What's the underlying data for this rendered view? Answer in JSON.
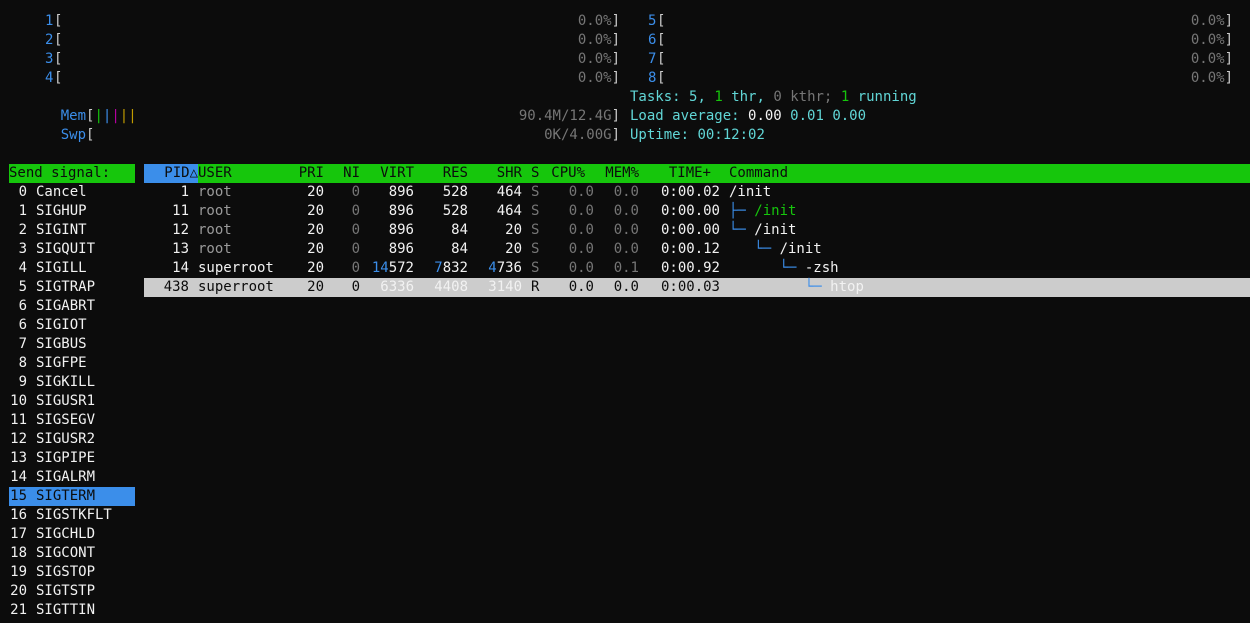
{
  "cpus_left": [
    {
      "num": "1",
      "value": "0.0%"
    },
    {
      "num": "2",
      "value": "0.0%"
    },
    {
      "num": "3",
      "value": "0.0%"
    },
    {
      "num": "4",
      "value": "0.0%"
    }
  ],
  "cpus_right": [
    {
      "num": "5",
      "value": "0.0%"
    },
    {
      "num": "6",
      "value": "0.0%"
    },
    {
      "num": "7",
      "value": "0.0%"
    },
    {
      "num": "8",
      "value": "0.0%"
    }
  ],
  "mem": {
    "label": "Mem",
    "value": "90.4M/12.4G"
  },
  "swp": {
    "label": "Swp",
    "value": "0K/4.00G"
  },
  "tasks": {
    "label": "Tasks:",
    "count": "5,",
    "thr": "1",
    "thr_label": "thr,",
    "kthr": "0",
    "kthr_label": "kthr;",
    "running": "1",
    "running_label": "running"
  },
  "load": {
    "label": "Load average:",
    "v1": "0.00",
    "v5": "0.01",
    "v15": "0.00"
  },
  "uptime": {
    "label": "Uptime:",
    "value": "00:12:02"
  },
  "signal_panel": {
    "title": "Send signal:",
    "items": [
      {
        "num": "0",
        "name": "Cancel"
      },
      {
        "num": "1",
        "name": "SIGHUP"
      },
      {
        "num": "2",
        "name": "SIGINT"
      },
      {
        "num": "3",
        "name": "SIGQUIT"
      },
      {
        "num": "4",
        "name": "SIGILL"
      },
      {
        "num": "5",
        "name": "SIGTRAP"
      },
      {
        "num": "6",
        "name": "SIGABRT"
      },
      {
        "num": "6",
        "name": "SIGIOT"
      },
      {
        "num": "7",
        "name": "SIGBUS"
      },
      {
        "num": "8",
        "name": "SIGFPE"
      },
      {
        "num": "9",
        "name": "SIGKILL"
      },
      {
        "num": "10",
        "name": "SIGUSR1"
      },
      {
        "num": "11",
        "name": "SIGSEGV"
      },
      {
        "num": "12",
        "name": "SIGUSR2"
      },
      {
        "num": "13",
        "name": "SIGPIPE"
      },
      {
        "num": "14",
        "name": "SIGALRM"
      },
      {
        "num": "15",
        "name": "SIGTERM"
      },
      {
        "num": "16",
        "name": "SIGSTKFLT"
      },
      {
        "num": "17",
        "name": "SIGCHLD"
      },
      {
        "num": "18",
        "name": "SIGCONT"
      },
      {
        "num": "19",
        "name": "SIGSTOP"
      },
      {
        "num": "20",
        "name": "SIGTSTP"
      },
      {
        "num": "21",
        "name": "SIGTTIN"
      }
    ],
    "selected_index": 16
  },
  "columns": {
    "pid": "PID△",
    "user": "USER",
    "pri": "PRI",
    "ni": "NI",
    "virt": "VIRT",
    "res": "RES",
    "shr": "SHR",
    "s": "S",
    "cpu": "CPU%",
    "mem": "MEM%",
    "time": "TIME+",
    "command": "Command"
  },
  "processes": [
    {
      "pid": "1",
      "user": "root",
      "pri": "20",
      "ni": "0",
      "virt_hi": "",
      "virt_lo": "896",
      "res_hi": "",
      "res_lo": "528",
      "shr_hi": "",
      "shr_lo": "464",
      "s": "S",
      "cpu": "0.0",
      "mem": "0.0",
      "time": "0:00.02",
      "tree": "",
      "cmd": "/init"
    },
    {
      "pid": "11",
      "user": "root",
      "pri": "20",
      "ni": "0",
      "virt_hi": "",
      "virt_lo": "896",
      "res_hi": "",
      "res_lo": "528",
      "shr_hi": "",
      "shr_lo": "464",
      "s": "S",
      "cpu": "0.0",
      "mem": "0.0",
      "time": "0:00.00",
      "tree": "├─ ",
      "cmd": "/init"
    },
    {
      "pid": "12",
      "user": "root",
      "pri": "20",
      "ni": "0",
      "virt_hi": "",
      "virt_lo": "896",
      "res_hi": "",
      "res_lo": "84",
      "shr_hi": "",
      "shr_lo": "20",
      "s": "S",
      "cpu": "0.0",
      "mem": "0.0",
      "time": "0:00.00",
      "tree": "└─ ",
      "cmd": "/init"
    },
    {
      "pid": "13",
      "user": "root",
      "pri": "20",
      "ni": "0",
      "virt_hi": "",
      "virt_lo": "896",
      "res_hi": "",
      "res_lo": "84",
      "shr_hi": "",
      "shr_lo": "20",
      "s": "S",
      "cpu": "0.0",
      "mem": "0.0",
      "time": "0:00.12",
      "tree": "   └─ ",
      "cmd": "/init"
    },
    {
      "pid": "14",
      "user": "superroot",
      "pri": "20",
      "ni": "0",
      "virt_hi": "14",
      "virt_lo": "572",
      "res_hi": "7",
      "res_lo": "832",
      "shr_hi": "4",
      "shr_lo": "736",
      "s": "S",
      "cpu": "0.0",
      "mem": "0.1",
      "time": "0:00.92",
      "tree": "      └─ ",
      "cmd": "-zsh"
    },
    {
      "pid": "438",
      "user": "superroot",
      "pri": "20",
      "ni": "0",
      "virt_hi": "",
      "virt_lo": "6336",
      "res_hi": "",
      "res_lo": "4408",
      "shr_hi": "",
      "shr_lo": "3140",
      "s": "R",
      "cpu": "0.0",
      "mem": "0.0",
      "time": "0:00.03",
      "tree": "         └─ ",
      "cmd": "htop"
    }
  ],
  "selected_process_index": 5,
  "colors": {
    "accent_blue": "#3b8eea",
    "header_green": "#16c60c",
    "cyan": "#61d6d6",
    "background": "#0c0c0c"
  }
}
